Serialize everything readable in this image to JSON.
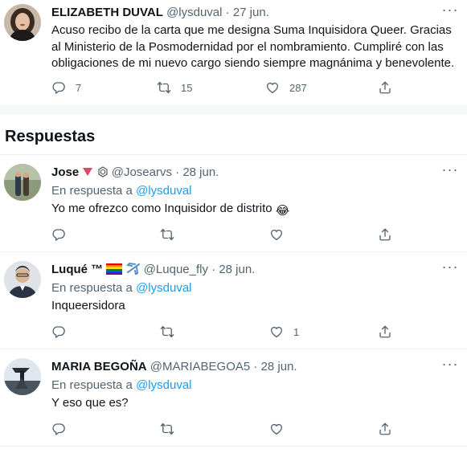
{
  "main_tweet": {
    "author_name": "ELIZABETH DUVAL",
    "handle": "@lysduval",
    "separator": "·",
    "date": "27 jun.",
    "text": "Acuso recibo de la carta que me designa Suma Inquisidora Queer. Gracias al Ministerio de la Posmodernidad por el nombramiento. Cumpliré con las obligaciones de mi nuevo cargo siendo siempre magnánima y benevolente.",
    "reply_count": "7",
    "retweet_count": "15",
    "like_count": "287"
  },
  "replies_section": {
    "title": "Respuestas"
  },
  "replies": [
    {
      "author_name": "Jose",
      "handle": "@Josearvs",
      "separator": "·",
      "date": "28 jun.",
      "reply_label": "En respuesta a",
      "reply_handle": "@lysduval",
      "text": "Yo me ofrezco como Inquisidor de distrito",
      "emoji": "😂",
      "like_count": ""
    },
    {
      "author_name": "Luqué ™",
      "handle": "@Luque_fly",
      "separator": "·",
      "date": "28 jun.",
      "reply_label": "En respuesta a",
      "reply_handle": "@lysduval",
      "text": "Inqueersidora",
      "like_count": "1"
    },
    {
      "author_name": "MARIA BEGOÑA",
      "handle": "@MARIABEGOA5",
      "separator": "·",
      "date": "28 jun.",
      "reply_label": "En respuesta a",
      "reply_handle": "@lysduval",
      "text": "Y eso que es?",
      "like_count": ""
    }
  ],
  "icons": {
    "reply": "reply-icon",
    "retweet": "retweet-icon",
    "like": "heart-icon",
    "share": "share-icon",
    "more": "more-options-icon"
  },
  "colors": {
    "link": "#1d9bf0",
    "secondary_text": "#536471",
    "primary_text": "#0f1419",
    "divider": "#eff3f4"
  }
}
